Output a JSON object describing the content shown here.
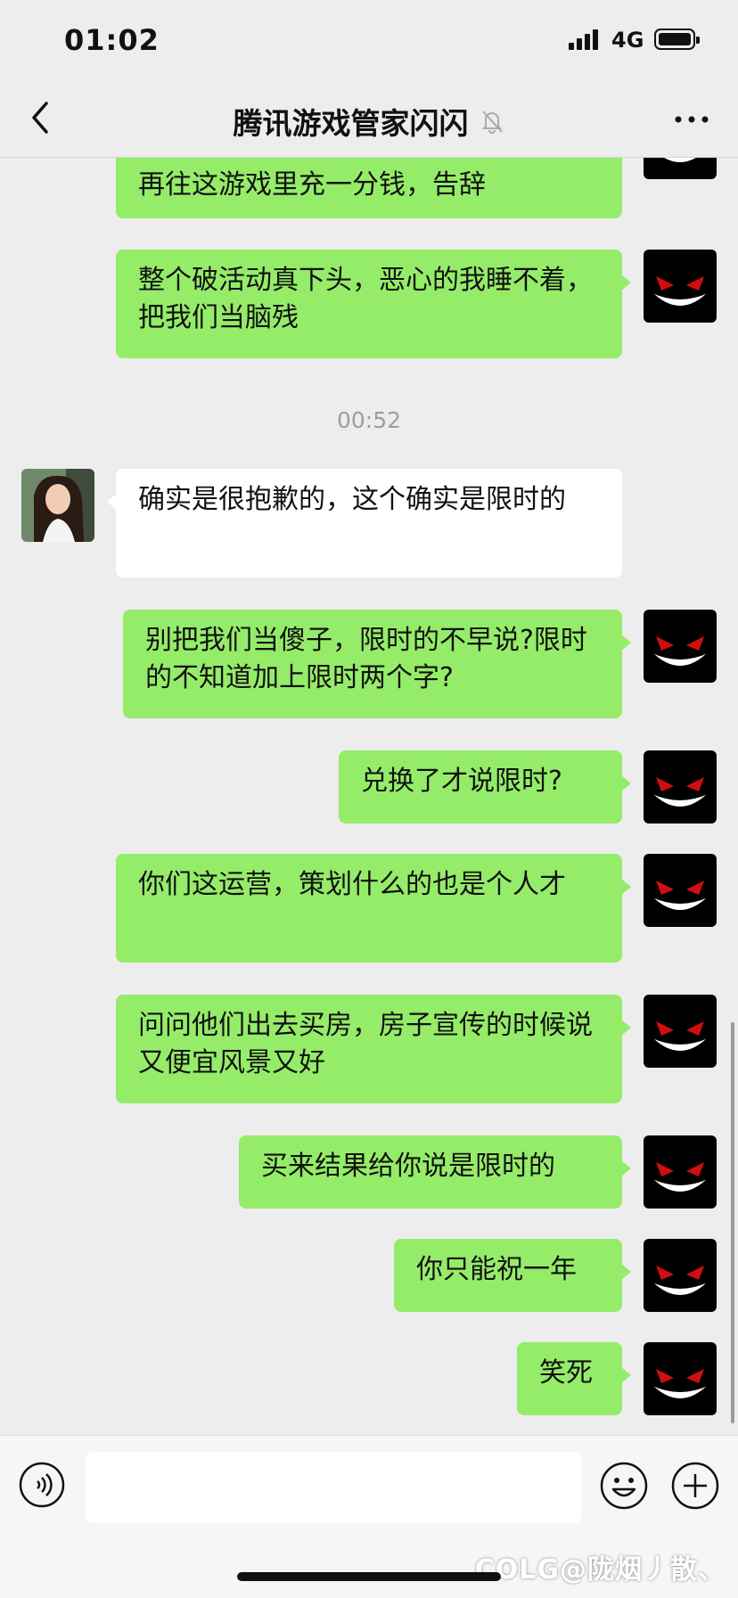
{
  "status_bar": {
    "time": "01:02",
    "network": "4G"
  },
  "header": {
    "title": "腾讯游戏管家闪闪"
  },
  "messages": [
    {
      "from": "me",
      "text": "再往这游戏里充一分钱，告辞"
    },
    {
      "from": "me",
      "text": "整个破活动真下头，恶心的我睡不着，把我们当脑残"
    },
    {
      "from": "them",
      "text": "确实是很抱歉的，这个确实是限时的"
    },
    {
      "from": "me",
      "text": "别把我们当傻子，限时的不早说?限时的不知道加上限时两个字?"
    },
    {
      "from": "me",
      "text": "兑换了才说限时?"
    },
    {
      "from": "me",
      "text": "你们这运营，策划什么的也是个人才"
    },
    {
      "from": "me",
      "text": "问问他们出去买房，房子宣传的时候说又便宜风景又好"
    },
    {
      "from": "me",
      "text": "买来结果给你说是限时的"
    },
    {
      "from": "me",
      "text": "你只能祝一年"
    },
    {
      "from": "me",
      "text": "笑死"
    }
  ],
  "timestamp": "00:52",
  "input": {
    "value": ""
  },
  "watermark": "COLG@陇烟丿散、",
  "colors": {
    "bubble_me": "#95ec69",
    "bubble_them": "#ffffff",
    "background": "#ededed"
  },
  "icons": [
    "back-icon",
    "mute-bell-icon",
    "more-icon",
    "voice-icon",
    "emoji-icon",
    "plus-icon"
  ]
}
